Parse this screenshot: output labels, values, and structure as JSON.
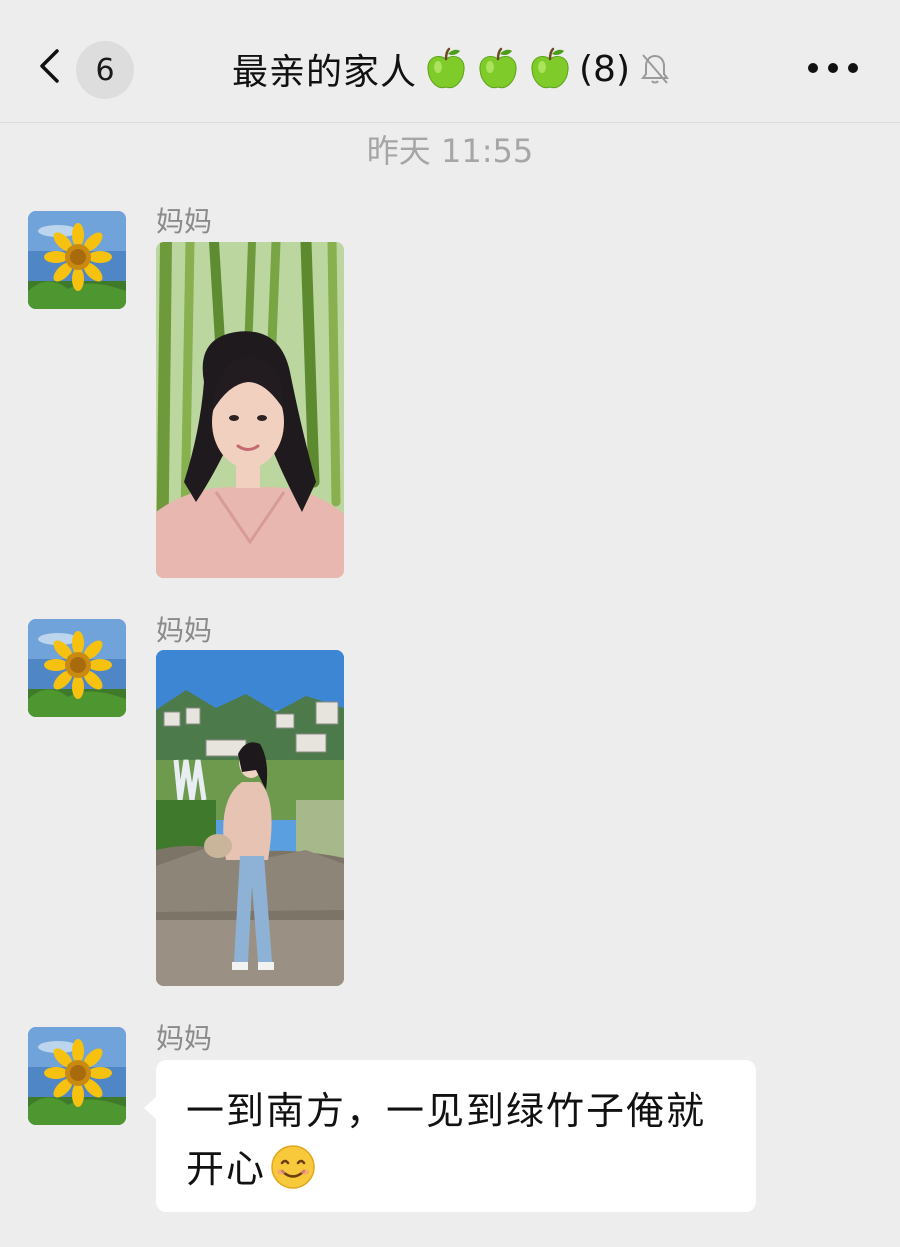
{
  "header": {
    "unread_count": "6",
    "chat_title": "最亲的家人",
    "title_emoji": [
      "green-apple",
      "green-apple",
      "green-apple"
    ],
    "member_count": "(8)",
    "muted": true
  },
  "timestamp": "昨天 11:55",
  "messages": [
    {
      "sender": "妈妈",
      "type": "image",
      "image_description": "selfie"
    },
    {
      "sender": "妈妈",
      "type": "image",
      "image_description": "landscape"
    },
    {
      "sender": "妈妈",
      "type": "text",
      "text_line1": "一到南方，一见到绿竹子俺就",
      "text_line2": "开心",
      "emoji": "smiling-face"
    }
  ],
  "colors": {
    "background": "#ededed",
    "bubble": "#ffffff",
    "muted_text": "#a6a6a6",
    "sender_name": "#8a8a8a"
  }
}
